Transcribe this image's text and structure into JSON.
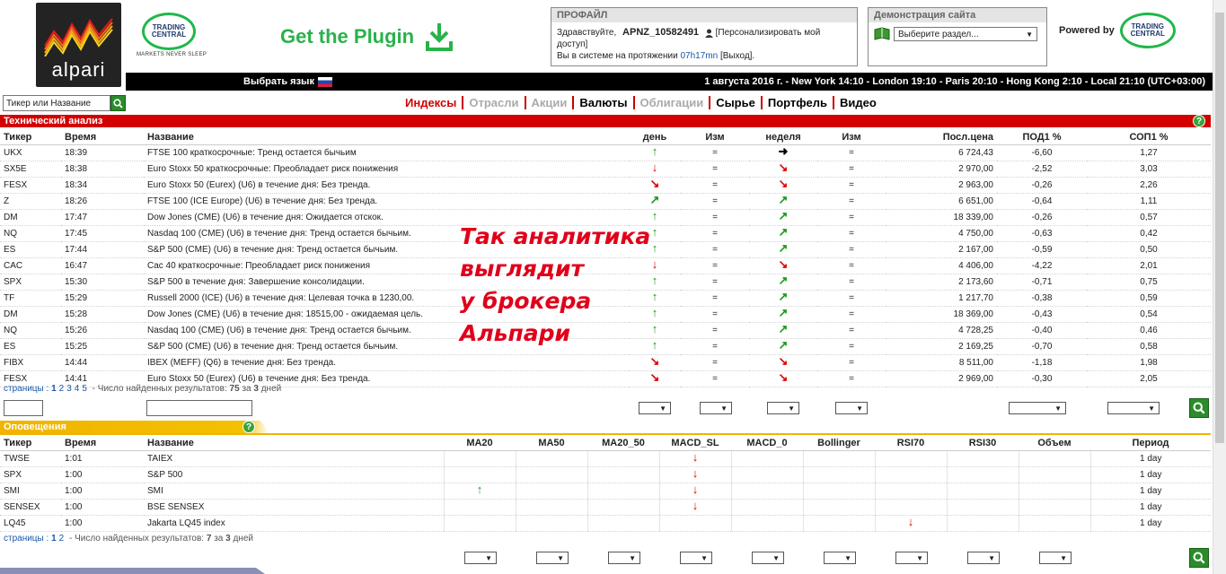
{
  "header": {
    "logo_text": "alpari",
    "tc_line1": "TRADING",
    "tc_line2": "CENTRAL",
    "tc_tagline": "MARKETS NEVER SLEEP",
    "plugin_label": "Get the Plugin",
    "powered_by": "Powered by",
    "brand_color": "#2ab24a"
  },
  "profile": {
    "title": "ПРОФАЙЛ",
    "greeting": "Здравствуйте,",
    "username": "APNZ_10582491",
    "personalize": "[Персонализировать мой доступ]",
    "session_prefix": "Вы в системе на протяжении",
    "session_time": "07h17mn",
    "logout": "[Выход]."
  },
  "demo": {
    "title": "Демонстрация сайта",
    "select_value": "Выберите раздел..."
  },
  "topbar": {
    "language_label": "Выбрать язык",
    "times": "1 августа 2016 г.  - New York 14:10  - London 19:10  - Paris 20:10  - Hong Kong 2:10  - Local 21:10 (UTC+03:00)"
  },
  "search": {
    "placeholder": "Тикер или Название"
  },
  "nav": [
    {
      "label": "Индексы",
      "color": "#d00000"
    },
    {
      "label": "Отрасли",
      "color": "#aaaaaa"
    },
    {
      "label": "Акции",
      "color": "#aaaaaa"
    },
    {
      "label": "Валюты",
      "color": "#000000"
    },
    {
      "label": "Облигации",
      "color": "#aaaaaa"
    },
    {
      "label": "Сырье",
      "color": "#000000"
    },
    {
      "label": "Портфель",
      "color": "#000000"
    },
    {
      "label": "Видео",
      "color": "#000000"
    }
  ],
  "tech": {
    "title": "Технический анализ",
    "headers": [
      "Тикер",
      "Время",
      "Название",
      "день",
      "Изм",
      "неделя",
      "Изм",
      "Посл.цена",
      "ПОД1 %",
      "СОП1 %"
    ],
    "rows": [
      {
        "t": "UKX",
        "time": "18:39",
        "name": "FTSE 100 краткосрочные: Тренд остается бычьим",
        "day": "up",
        "dchg": "=",
        "week": "right",
        "wchg": "=",
        "price": "6 724,43",
        "s1": "-6,60",
        "r1": "1,27"
      },
      {
        "t": "SX5E",
        "time": "18:38",
        "name": "Euro Stoxx 50 краткосрочные: Преобладает риск понижения",
        "day": "down",
        "dchg": "=",
        "week": "down-right",
        "wchg": "=",
        "price": "2 970,00",
        "s1": "-2,52",
        "r1": "3,03"
      },
      {
        "t": "FESX",
        "time": "18:34",
        "name": "Euro Stoxx 50 (Eurex) (U6) в течение дня: Без тренда.",
        "day": "down-right",
        "dchg": "=",
        "week": "down-right",
        "wchg": "=",
        "price": "2 963,00",
        "s1": "-0,26",
        "r1": "2,26"
      },
      {
        "t": "Z",
        "time": "18:26",
        "name": "FTSE 100 (ICE Europe) (U6) в течение дня: Без тренда.",
        "day": "up-right",
        "dchg": "=",
        "week": "up-right",
        "wchg": "=",
        "price": "6 651,00",
        "s1": "-0,64",
        "r1": "1,11"
      },
      {
        "t": "DM",
        "time": "17:47",
        "name": "Dow Jones (CME) (U6) в течение дня: Ожидается отскок.",
        "day": "up",
        "dchg": "=",
        "week": "up-right",
        "wchg": "=",
        "price": "18 339,00",
        "s1": "-0,26",
        "r1": "0,57"
      },
      {
        "t": "NQ",
        "time": "17:45",
        "name": "Nasdaq 100 (CME) (U6) в течение дня: Тренд остается бычьим.",
        "day": "up",
        "dchg": "=",
        "week": "up-right",
        "wchg": "=",
        "price": "4 750,00",
        "s1": "-0,63",
        "r1": "0,42"
      },
      {
        "t": "ES",
        "time": "17:44",
        "name": "S&P 500 (CME) (U6) в течение дня: Тренд остается бычьим.",
        "day": "up",
        "dchg": "=",
        "week": "up-right",
        "wchg": "=",
        "price": "2 167,00",
        "s1": "-0,59",
        "r1": "0,50"
      },
      {
        "t": "CAC",
        "time": "16:47",
        "name": "Cac 40 краткосрочные: Преобладает риск понижения",
        "day": "down",
        "dchg": "=",
        "week": "down-right",
        "wchg": "=",
        "price": "4 406,00",
        "s1": "-4,22",
        "r1": "2,01"
      },
      {
        "t": "SPX",
        "time": "15:30",
        "name": "S&P 500 в течение дня: Завершение консолидации.",
        "day": "up",
        "dchg": "=",
        "week": "up-right",
        "wchg": "=",
        "price": "2 173,60",
        "s1": "-0,71",
        "r1": "0,75"
      },
      {
        "t": "TF",
        "time": "15:29",
        "name": "Russell 2000 (ICE) (U6) в течение дня: Целевая точка в 1230,00.",
        "day": "up",
        "dchg": "=",
        "week": "up-right",
        "wchg": "=",
        "price": "1 217,70",
        "s1": "-0,38",
        "r1": "0,59"
      },
      {
        "t": "DM",
        "time": "15:28",
        "name": "Dow Jones (CME) (U6) в течение дня: 18515,00 - ожидаемая цель.",
        "day": "up",
        "dchg": "=",
        "week": "up-right",
        "wchg": "=",
        "price": "18 369,00",
        "s1": "-0,43",
        "r1": "0,54"
      },
      {
        "t": "NQ",
        "time": "15:26",
        "name": "Nasdaq 100 (CME) (U6) в течение дня: Тренд остается бычьим.",
        "day": "up",
        "dchg": "=",
        "week": "up-right",
        "wchg": "=",
        "price": "4 728,25",
        "s1": "-0,40",
        "r1": "0,46"
      },
      {
        "t": "ES",
        "time": "15:25",
        "name": "S&P 500 (CME) (U6) в течение дня: Тренд остается бычьим.",
        "day": "up",
        "dchg": "=",
        "week": "up-right",
        "wchg": "=",
        "price": "2 169,25",
        "s1": "-0,70",
        "r1": "0,58"
      },
      {
        "t": "FIBX",
        "time": "14:44",
        "name": "IBEX (MEFF) (Q6) в течение дня: Без тренда.",
        "day": "down-right",
        "dchg": "=",
        "week": "down-right",
        "wchg": "=",
        "price": "8 511,00",
        "s1": "-1,18",
        "r1": "1,98"
      },
      {
        "t": "FESX",
        "time": "14:41",
        "name": "Euro Stoxx 50 (Eurex) (U6) в течение дня: Без тренда.",
        "day": "down-right",
        "dchg": "=",
        "week": "down-right",
        "wchg": "=",
        "price": "2 969,00",
        "s1": "-0,30",
        "r1": "2,05"
      }
    ],
    "pager_label": "страницы :",
    "pages": [
      "1",
      "2",
      "3",
      "4",
      "5"
    ],
    "found_prefix": "- Число найденных результатов:",
    "found_count": "75",
    "found_mid": "за",
    "found_days": "3",
    "found_suffix": "дней"
  },
  "alerts": {
    "title": "Оповещения",
    "headers": [
      "Тикер",
      "Время",
      "Название",
      "MA20",
      "MA50",
      "MA20_50",
      "MACD_SL",
      "MACD_0",
      "Bollinger",
      "RSI70",
      "RSI30",
      "Объем",
      "Период"
    ],
    "rows": [
      {
        "t": "TWSE",
        "time": "1:01",
        "name": "TAIEX",
        "sig": {
          "MACD_SL": "down"
        },
        "period": "1 day"
      },
      {
        "t": "SPX",
        "time": "1:00",
        "name": "S&P 500",
        "sig": {
          "MACD_SL": "down"
        },
        "period": "1 day"
      },
      {
        "t": "SMI",
        "time": "1:00",
        "name": "SMI",
        "sig": {
          "MA20": "up",
          "MACD_SL": "down"
        },
        "period": "1 day"
      },
      {
        "t": "SENSEX",
        "time": "1:00",
        "name": "BSE SENSEX",
        "sig": {
          "MACD_SL": "down"
        },
        "period": "1 day"
      },
      {
        "t": "LQ45",
        "time": "1:00",
        "name": "Jakarta LQ45 index",
        "sig": {
          "RSI70": "down"
        },
        "period": "1 day"
      }
    ],
    "pager_label": "страницы :",
    "pages": [
      "1",
      "2"
    ],
    "found_prefix": "- Число найденных результатов:",
    "found_count": "7",
    "found_mid": "за",
    "found_days": "3",
    "found_suffix": "дней"
  },
  "annotation": {
    "lines": [
      "Так аналитика",
      "выглядит",
      "у брокера",
      "Альпари"
    ]
  },
  "icons": {
    "search": "search-icon",
    "help": "help-icon",
    "download": "download-icon",
    "user": "user-icon",
    "flag": "russian-flag-icon"
  },
  "symbols": {
    "help": "?",
    "select_arrow": "▼"
  }
}
